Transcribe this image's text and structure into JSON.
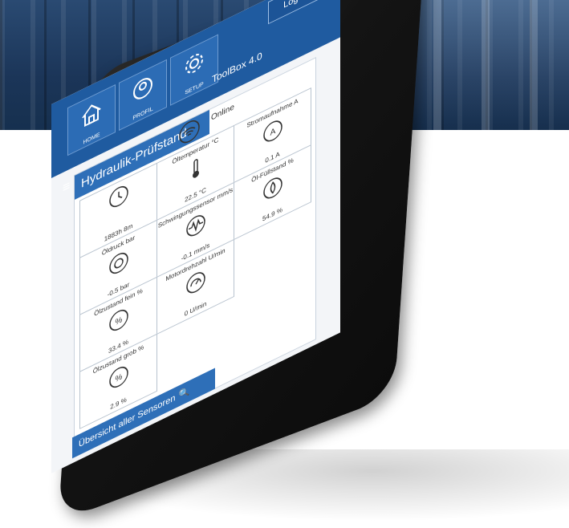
{
  "app": {
    "brand": "ToolBox 4.0",
    "logout_label": "Logout",
    "nav": [
      {
        "label": "HOME",
        "icon": "home-icon"
      },
      {
        "label": "PROFIL",
        "icon": "profile-icon"
      },
      {
        "label": "SETUP",
        "icon": "gear-icon"
      }
    ]
  },
  "station": {
    "title": "Hydraulik-Prüfstand",
    "status": "Online",
    "operating_hours": "1883h 8m"
  },
  "sensors": [
    {
      "label": "Öltemperatur °C",
      "value": "22.5 °C",
      "icon": "thermometer-icon"
    },
    {
      "label": "Stromaufnahme A",
      "value": "0.1 A",
      "icon": "ammeter-icon"
    },
    {
      "label": "Öldruck bar",
      "value": "-0.5 bar",
      "icon": "pressure-gauge-icon"
    },
    {
      "label": "Schwingungssensor mm/s",
      "value": "-0.1 mm/s",
      "icon": "vibration-icon"
    },
    {
      "label": "Öl-Füllstand %",
      "value": "54.9 %",
      "icon": "oil-level-icon"
    },
    {
      "label": "Ölzustand fein %",
      "value": "33.4 %",
      "icon": "percent-icon"
    },
    {
      "label": "Motordrehzahl U/min",
      "value": "0 U/min",
      "icon": "rpm-icon"
    },
    {
      "label": "Ölzustand grob %",
      "value": "2.9 %",
      "icon": "percent-icon"
    }
  ],
  "footer": {
    "overview_label": "Übersicht aller Sensoren"
  },
  "colors": {
    "primary": "#1f5ba0",
    "accent": "#2e6fb8",
    "card_border": "#b8c3cf"
  }
}
